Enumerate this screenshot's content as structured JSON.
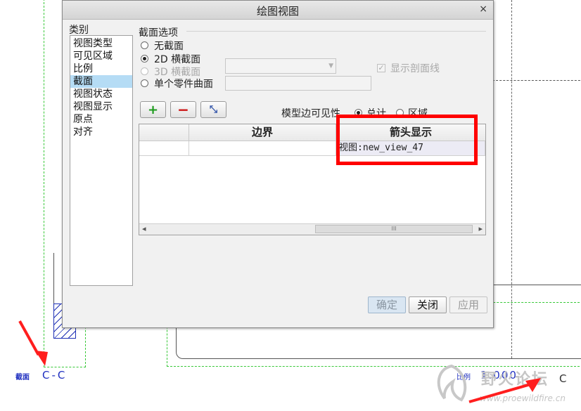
{
  "dialog": {
    "title": "绘图视图",
    "close_glyph": "×",
    "category_label": "类别",
    "categories": [
      "视图类型",
      "可见区域",
      "比例",
      "截面",
      "视图状态",
      "视图显示",
      "原点",
      "对齐"
    ],
    "selected_category": "截面",
    "section_options": {
      "group_label": "截面选项",
      "radio_none": "无截面",
      "radio_2d": "2D 横截面",
      "radio_3d": "3D 横截面",
      "radio_single": "单个零件曲面",
      "selected": "2D 横截面",
      "show_hatch_label": "显示剖面线",
      "show_hatch_checked": true
    },
    "toolbar": {
      "add_glyph": "+",
      "remove_glyph": "−",
      "edit_glyph": "⤡"
    },
    "model_edge_visibility": {
      "label": "模型边可见性",
      "option_total": "总计",
      "option_region": "区域",
      "selected": "总计"
    },
    "table": {
      "columns": [
        "",
        "边界",
        "箭头显示"
      ],
      "rows": [
        {
          "name": "",
          "boundary": "",
          "arrow": "视图:new_view_47"
        }
      ],
      "scroll_thumb": "III",
      "scroll_left": "◂",
      "scroll_right": "▸"
    },
    "buttons": {
      "ok": "确定",
      "close": "关闭",
      "apply": "应用"
    }
  },
  "drawing": {
    "section_label_left": "截面",
    "section_name_left": "C-C",
    "scale_label": "比例",
    "scale_value": "1.000",
    "section_name_right": "C",
    "watermark_cn": "野火论坛",
    "watermark_url": "www.proewildfire.cn"
  },
  "colors": {
    "annotation_red": "#ff0000",
    "cad_blue": "#2030c0",
    "cad_green": "#38c838",
    "selection_blue": "#b5dcf5"
  }
}
